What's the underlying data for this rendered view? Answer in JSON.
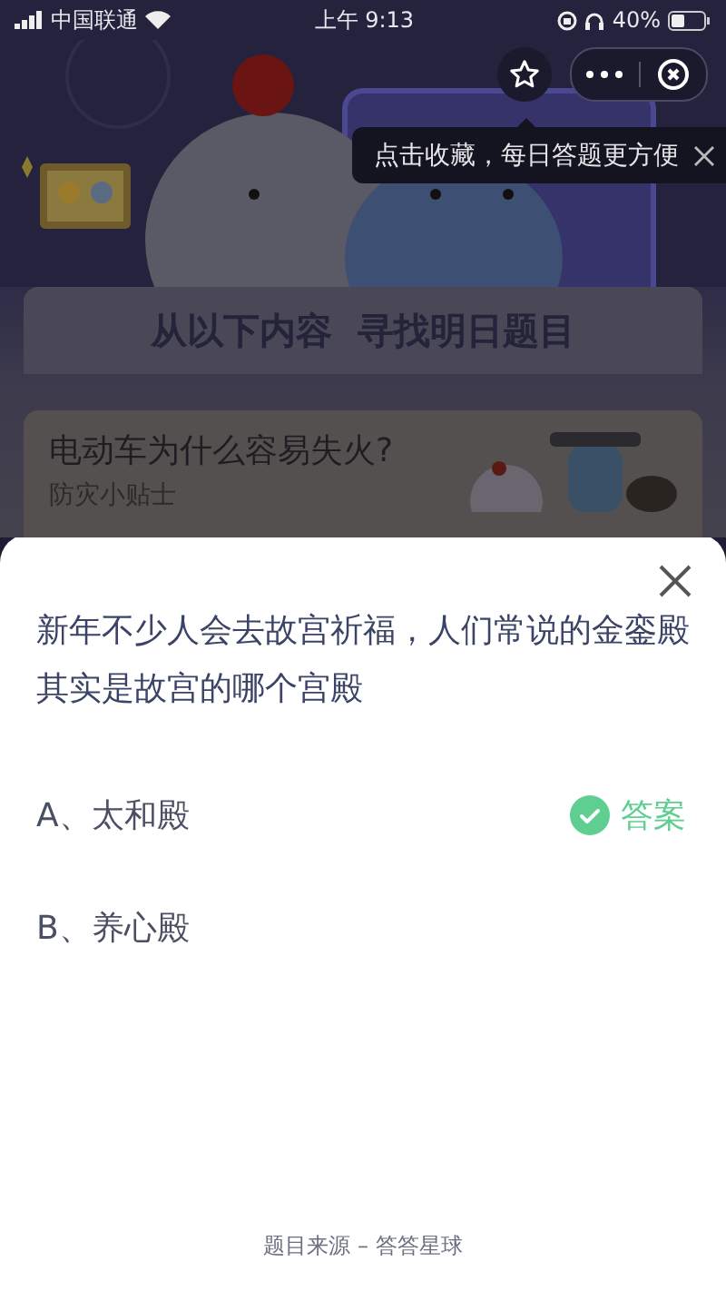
{
  "status_bar": {
    "carrier": "中国联通",
    "time": "上午 9:13",
    "battery": "40%"
  },
  "mini_program": {
    "tooltip": "点击收藏，每日答题更方便"
  },
  "page": {
    "heading": "从以下内容  寻找明日题目",
    "article_title": "电动车为什么容易失火?",
    "article_tag": "防灾小贴士"
  },
  "quiz": {
    "question": "新年不少人会去故宫祈福，人们常说的金銮殿其实是故宫的哪个宫殿",
    "answer_badge": "答案",
    "options": [
      {
        "label": "A、太和殿",
        "correct": true
      },
      {
        "label": "B、养心殿",
        "correct": false
      }
    ],
    "source": "题目来源 – 答答星球"
  }
}
